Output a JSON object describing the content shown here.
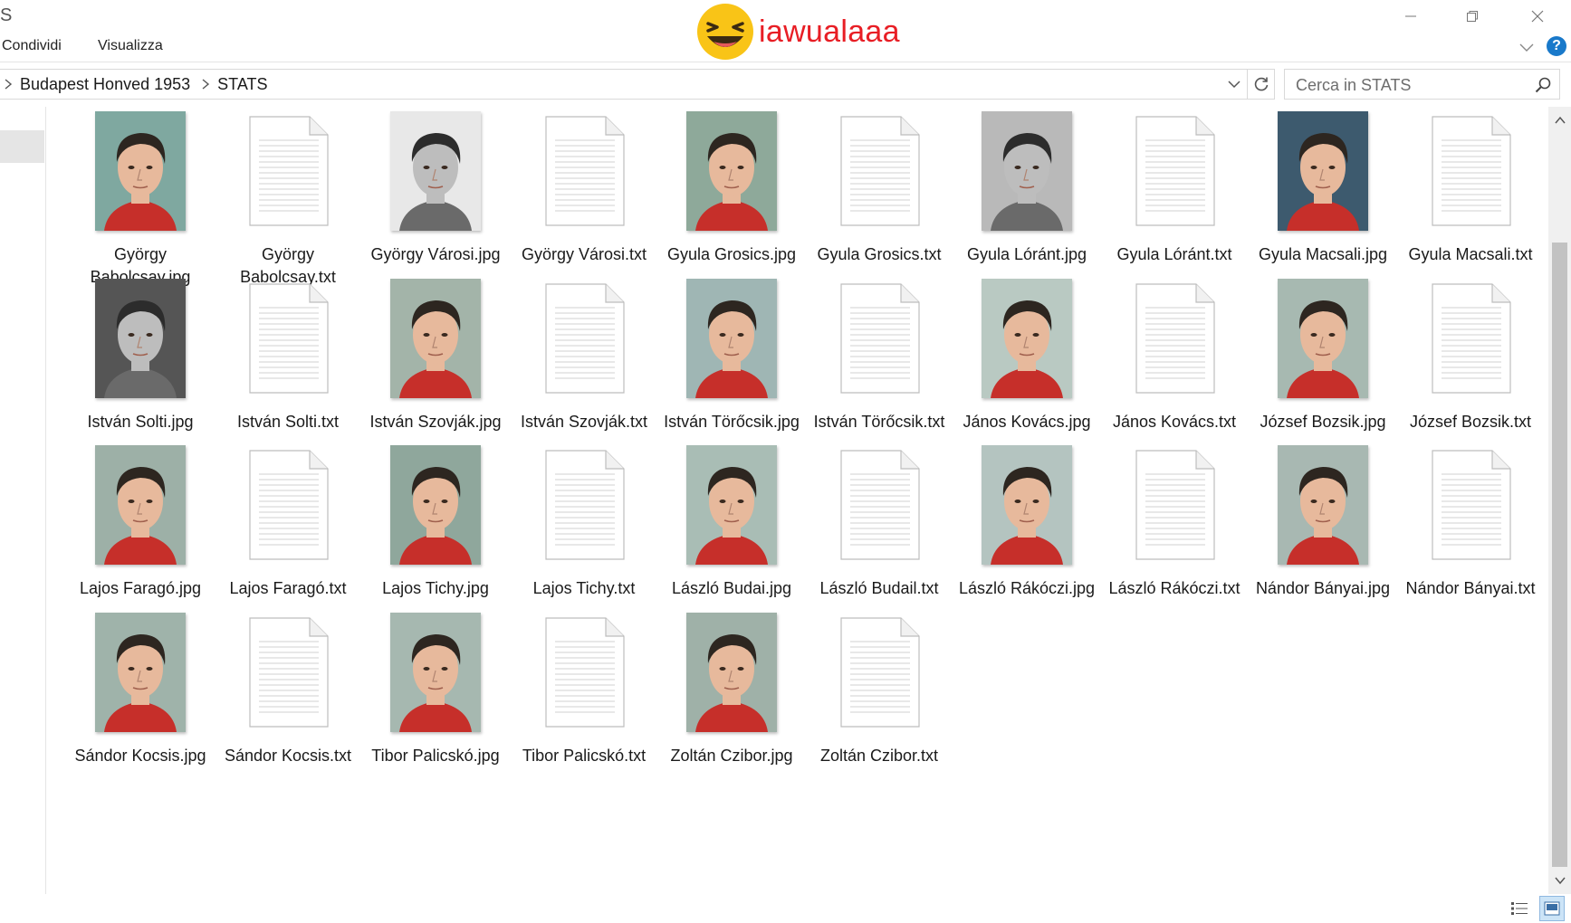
{
  "window": {
    "title_fragment": "S",
    "brand_text": "iawualaaa"
  },
  "ribbon": {
    "tabs": [
      "Condividi",
      "Visualizza"
    ]
  },
  "address": {
    "breadcrumbs": [
      "Budapest Honved 1953",
      "STATS"
    ]
  },
  "search": {
    "placeholder": "Cerca in STATS"
  },
  "files": [
    {
      "name": "György Babolcsay.jpg",
      "type": "jpg",
      "tone": "color",
      "bg": "#7fa8a0"
    },
    {
      "name": "György Babolcsay.txt",
      "type": "txt"
    },
    {
      "name": "György Városi.jpg",
      "type": "jpg",
      "tone": "bw",
      "bg": "#e8e8e8"
    },
    {
      "name": "György Városi.txt",
      "type": "txt"
    },
    {
      "name": "Gyula Grosics.jpg",
      "type": "jpg",
      "tone": "color",
      "bg": "#8ea99a"
    },
    {
      "name": "Gyula Grosics.txt",
      "type": "txt"
    },
    {
      "name": "Gyula Lóránt.jpg",
      "type": "jpg",
      "tone": "bw",
      "bg": "#b9b9b9"
    },
    {
      "name": "Gyula Lóránt.txt",
      "type": "txt"
    },
    {
      "name": "Gyula Macsali.jpg",
      "type": "jpg",
      "tone": "color",
      "bg": "#3d5a6e"
    },
    {
      "name": "Gyula Macsali.txt",
      "type": "txt"
    },
    {
      "name": "István Solti.jpg",
      "type": "jpg",
      "tone": "bw",
      "bg": "#555555"
    },
    {
      "name": "István Solti.txt",
      "type": "txt"
    },
    {
      "name": "István Szovják.jpg",
      "type": "jpg",
      "tone": "color",
      "bg": "#a3b4a9"
    },
    {
      "name": "István Szovják.txt",
      "type": "txt"
    },
    {
      "name": "István Törőcsik.jpg",
      "type": "jpg",
      "tone": "color",
      "bg": "#9fb6b4"
    },
    {
      "name": "István Törőcsik.txt",
      "type": "txt"
    },
    {
      "name": "János Kovács.jpg",
      "type": "jpg",
      "tone": "color",
      "bg": "#b9c9c2"
    },
    {
      "name": "János Kovács.txt",
      "type": "txt"
    },
    {
      "name": "József Bozsik.jpg",
      "type": "jpg",
      "tone": "color",
      "bg": "#a7b9b1"
    },
    {
      "name": "József Bozsik.txt",
      "type": "txt"
    },
    {
      "name": "Lajos Faragó.jpg",
      "type": "jpg",
      "tone": "color",
      "bg": "#9db0a7"
    },
    {
      "name": "Lajos Faragó.txt",
      "type": "txt"
    },
    {
      "name": "Lajos Tichy.jpg",
      "type": "jpg",
      "tone": "color",
      "bg": "#8fa79c"
    },
    {
      "name": "Lajos Tichy.txt",
      "type": "txt"
    },
    {
      "name": "László Budai.jpg",
      "type": "jpg",
      "tone": "color",
      "bg": "#a9bdb5"
    },
    {
      "name": "László Budail.txt",
      "type": "txt"
    },
    {
      "name": "László Rákóczi.jpg",
      "type": "jpg",
      "tone": "color",
      "bg": "#b4c4c0"
    },
    {
      "name": "László Rákóczi.txt",
      "type": "txt"
    },
    {
      "name": "Nándor Bányai.jpg",
      "type": "jpg",
      "tone": "color",
      "bg": "#a8b8b2"
    },
    {
      "name": "Nándor Bányai.txt",
      "type": "txt"
    },
    {
      "name": "Sándor Kocsis.jpg",
      "type": "jpg",
      "tone": "color",
      "bg": "#9fb3aa"
    },
    {
      "name": "Sándor Kocsis.txt",
      "type": "txt"
    },
    {
      "name": "Tibor Palicskó.jpg",
      "type": "jpg",
      "tone": "color",
      "bg": "#a6b8b0"
    },
    {
      "name": "Tibor Palicskó.txt",
      "type": "txt"
    },
    {
      "name": "Zoltán Czibor.jpg",
      "type": "jpg",
      "tone": "color",
      "bg": "#9fb1a8"
    },
    {
      "name": "Zoltán Czibor.txt",
      "type": "txt"
    }
  ],
  "icons": {
    "brand": "laughing-emoji-icon",
    "minimize": "minimize-icon",
    "maximize": "restore-icon",
    "close": "close-icon",
    "ribbon_toggle": "chevron-down-icon",
    "help": "help-icon",
    "breadcrumb_sep": "chevron-right-icon",
    "refresh": "refresh-icon",
    "search": "search-icon",
    "view_details": "details-view-icon",
    "view_large": "large-icons-view-icon"
  },
  "help_label": "?",
  "colors": {
    "accent": "#1979ca",
    "brand_text": "#e81e25",
    "selection": "#cce4f7"
  }
}
